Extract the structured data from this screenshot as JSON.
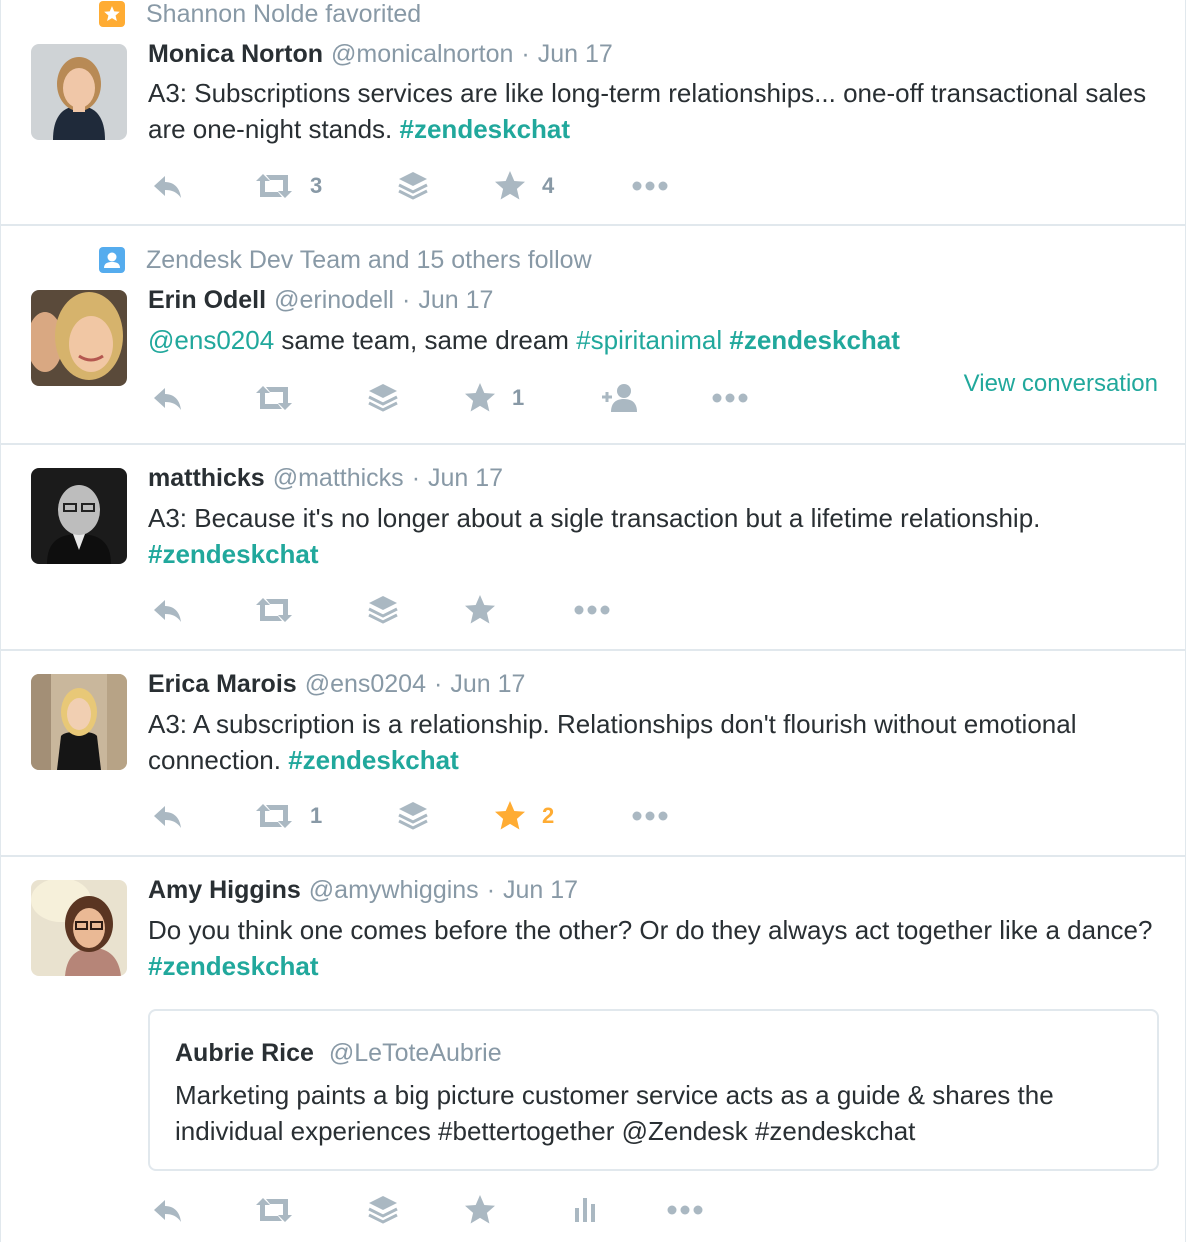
{
  "tweets": [
    {
      "context": "Shannon Nolde favorited",
      "context_icon": "star-badge-icon",
      "name": "Monica Norton",
      "handle": "@monicalnorton",
      "date": "Jun 17",
      "text_parts": [
        "A3: Subscriptions services are like long-term relationships... one-off transactional sales are one-night stands.",
        "#zendeskchat"
      ],
      "retweets": "3",
      "favorites": "4"
    },
    {
      "context": "Zendesk Dev Team and 15 others follow",
      "context_icon": "user-badge-icon",
      "name": "Erin Odell",
      "handle": "@erinodell",
      "date": "Jun 17",
      "text_parts": [
        "@ens0204",
        "same team, same dream",
        "#spiritanimal",
        "#zendeskchat"
      ],
      "favorites": "1",
      "view_conversation": "View conversation"
    },
    {
      "name": "matthicks",
      "handle": "@matthicks",
      "date": "Jun 17",
      "text_parts": [
        "A3: Because it's no longer about a sigle transaction but a lifetime relationship.",
        "#zendeskchat"
      ]
    },
    {
      "name": "Erica Marois",
      "handle": "@ens0204",
      "date": "Jun 17",
      "text_parts": [
        "A3: A subscription is a relationship. Relationships don't flourish without emotional connection.",
        "#zendeskchat"
      ],
      "retweets": "1",
      "favorites": "2",
      "favorited": true
    },
    {
      "name": "Amy Higgins",
      "handle": "@amywhiggins",
      "date": "Jun 17",
      "text_parts": [
        "Do you think one comes before the other? Or do they always act together like a dance?",
        "#zendeskchat"
      ],
      "quote": {
        "name": "Aubrie Rice",
        "handle": "@LeToteAubrie",
        "text": "Marketing paints a big picture customer service acts as a guide & shares the individual experiences #bettertogether @Zendesk #zendeskchat"
      }
    }
  ],
  "colors": {
    "link": "#21a89c",
    "muted": "#8899a6",
    "favorite": "#ffac33",
    "follow_badge": "#55acee",
    "border": "#e1e8ed"
  }
}
